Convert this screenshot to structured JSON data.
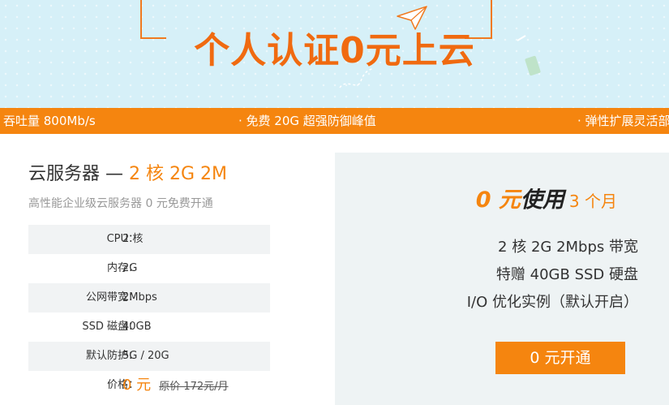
{
  "hero": {
    "title": "个人认证0元上云",
    "plane_icon": "paper-plane-icon",
    "accent_color": "#f06a10",
    "background_color": "#d6f0f8"
  },
  "ticker": {
    "items": [
      "吞吐量 800Mb/s",
      "· 免费 20G 超强防御峰值",
      "· 弹性扩展灵活部"
    ],
    "background_color": "#f5850f"
  },
  "product": {
    "title_prefix": "云服务器 —",
    "title_accent": "2 核 2G 2M",
    "subtitle": "高性能企业级云服务器 0 元免费开通",
    "specs": [
      {
        "label": "CPU：",
        "value": "2 核"
      },
      {
        "label": "内存：",
        "value": "2G"
      },
      {
        "label": "公网带宽：",
        "value": "2Mbps"
      },
      {
        "label": "SSD 磁盘：",
        "value": "40GB"
      },
      {
        "label": "默认防护：",
        "value": "5G / 20G"
      }
    ],
    "price": {
      "label": "价格：",
      "current": "0 元",
      "original": "原价 172元/月"
    }
  },
  "offer": {
    "free": "0 元",
    "use": "使用",
    "duration": "3 个月",
    "features": [
      "2 核 2G 2Mbps 带宽",
      "特赠 40GB SSD 硬盘",
      "I/O 优化实例（默认开启）"
    ],
    "cta_label": "0 元开通"
  }
}
